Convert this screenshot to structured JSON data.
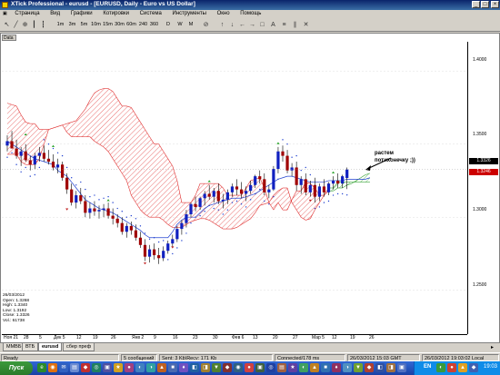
{
  "window": {
    "title": "XTick Professional - eurusd - [EURUSD, Daily - Euro vs US Dollar]",
    "min": "_",
    "max": "□",
    "close": "×"
  },
  "menu": [
    "Страница",
    "Вид",
    "Графики",
    "Котировки",
    "Система",
    "Инструменты",
    "Окно",
    "Помощь"
  ],
  "toolbar": {
    "timeframes": [
      "1m",
      "3m",
      "5m",
      "10m",
      "15m",
      "30m",
      "60m",
      "240",
      "360",
      "D",
      "W",
      "M"
    ]
  },
  "panel_label": "Data",
  "price_axis": {
    "ticks": [
      "1.4000",
      "1.3500",
      "1.3000",
      "1.2500"
    ],
    "last_price_tag": "1.3326",
    "bid_tag": "1.3246"
  },
  "time_axis": [
    "Ноя 21",
    "28",
    "5",
    "Дек 5",
    "12",
    "19",
    "26",
    "Янв 2",
    "9",
    "16",
    "23",
    "30",
    "Фев 6",
    "13",
    "20",
    "27",
    "Мар 5",
    "12",
    "19",
    "26"
  ],
  "infobox": {
    "date": "26/03/2012",
    "open": "Open: 1.3268",
    "high": "High: 1.3340",
    "low": "Low: 1.3192",
    "close": "Close: 1.3326",
    "vol": "Vol.: 61738"
  },
  "annotation": {
    "line1": "растем",
    "line2": "потихонечку ;))"
  },
  "tabs": [
    "ММВБ",
    "ВТБ",
    "eurusd",
    "сбер преф"
  ],
  "active_tab": "eurusd",
  "status": {
    "ready": "Ready",
    "messages": "5 сообщений",
    "traffic": "Sent: 3 Kb\\Recv: 171 Kb",
    "connected": "Connected/178 ms",
    "gmt": "26/03/2012 15:03 GMT",
    "local": "26/03/2012 19:03:02 Local"
  },
  "taskbar": {
    "start": "Пуск",
    "lang": "EN",
    "clock": "19:03"
  },
  "chart_data": {
    "type": "candlestick",
    "symbol": "EURUSD",
    "timeframe": "Daily",
    "ylim": [
      1.22,
      1.42
    ],
    "candles": [
      [
        1.349,
        1.356,
        1.345,
        1.352
      ],
      [
        1.352,
        1.359,
        1.348,
        1.347
      ],
      [
        1.347,
        1.353,
        1.34,
        1.342
      ],
      [
        1.342,
        1.348,
        1.335,
        1.345
      ],
      [
        1.345,
        1.35,
        1.338,
        1.339
      ],
      [
        1.339,
        1.342,
        1.332,
        1.336
      ],
      [
        1.336,
        1.344,
        1.333,
        1.342
      ],
      [
        1.342,
        1.348,
        1.338,
        1.344
      ],
      [
        1.344,
        1.349,
        1.338,
        1.34
      ],
      [
        1.34,
        1.346,
        1.336,
        1.338
      ],
      [
        1.338,
        1.343,
        1.332,
        1.334
      ],
      [
        1.334,
        1.34,
        1.33,
        1.336
      ],
      [
        1.336,
        1.338,
        1.325,
        1.327
      ],
      [
        1.327,
        1.33,
        1.316,
        1.319
      ],
      [
        1.319,
        1.323,
        1.308,
        1.31
      ],
      [
        1.31,
        1.318,
        1.306,
        1.315
      ],
      [
        1.315,
        1.32,
        1.309,
        1.311
      ],
      [
        1.311,
        1.315,
        1.3,
        1.303
      ],
      [
        1.303,
        1.31,
        1.299,
        1.306
      ],
      [
        1.306,
        1.311,
        1.301,
        1.304
      ],
      [
        1.304,
        1.308,
        1.299,
        1.305
      ],
      [
        1.305,
        1.309,
        1.3,
        1.306
      ],
      [
        1.306,
        1.31,
        1.299,
        1.301
      ],
      [
        1.301,
        1.306,
        1.295,
        1.299
      ],
      [
        1.299,
        1.302,
        1.293,
        1.296
      ],
      [
        1.296,
        1.3,
        1.288,
        1.29
      ],
      [
        1.29,
        1.296,
        1.286,
        1.294
      ],
      [
        1.294,
        1.297,
        1.288,
        1.291
      ],
      [
        1.291,
        1.295,
        1.284,
        1.286
      ],
      [
        1.286,
        1.29,
        1.279,
        1.281
      ],
      [
        1.281,
        1.285,
        1.27,
        1.273
      ],
      [
        1.273,
        1.281,
        1.269,
        1.278
      ],
      [
        1.278,
        1.282,
        1.271,
        1.274
      ],
      [
        1.274,
        1.279,
        1.268,
        1.272
      ],
      [
        1.272,
        1.28,
        1.27,
        1.277
      ],
      [
        1.277,
        1.284,
        1.275,
        1.282
      ],
      [
        1.282,
        1.288,
        1.279,
        1.285
      ],
      [
        1.285,
        1.294,
        1.283,
        1.292
      ],
      [
        1.292,
        1.298,
        1.288,
        1.296
      ],
      [
        1.296,
        1.305,
        1.293,
        1.302
      ],
      [
        1.302,
        1.31,
        1.3,
        1.309
      ],
      [
        1.309,
        1.314,
        1.304,
        1.307
      ],
      [
        1.307,
        1.314,
        1.305,
        1.313
      ],
      [
        1.313,
        1.318,
        1.308,
        1.316
      ],
      [
        1.316,
        1.322,
        1.312,
        1.314
      ],
      [
        1.314,
        1.32,
        1.31,
        1.318
      ],
      [
        1.318,
        1.323,
        1.309,
        1.311
      ],
      [
        1.311,
        1.316,
        1.306,
        1.312
      ],
      [
        1.312,
        1.319,
        1.309,
        1.317
      ],
      [
        1.317,
        1.323,
        1.314,
        1.321
      ],
      [
        1.321,
        1.326,
        1.315,
        1.319
      ],
      [
        1.319,
        1.324,
        1.313,
        1.316
      ],
      [
        1.316,
        1.321,
        1.311,
        1.318
      ],
      [
        1.318,
        1.325,
        1.316,
        1.322
      ],
      [
        1.322,
        1.329,
        1.32,
        1.328
      ],
      [
        1.328,
        1.332,
        1.323,
        1.326
      ],
      [
        1.326,
        1.33,
        1.315,
        1.317
      ],
      [
        1.317,
        1.322,
        1.313,
        1.319
      ],
      [
        1.319,
        1.335,
        1.318,
        1.333
      ],
      [
        1.333,
        1.348,
        1.33,
        1.345
      ],
      [
        1.345,
        1.349,
        1.338,
        1.342
      ],
      [
        1.342,
        1.346,
        1.33,
        1.332
      ],
      [
        1.332,
        1.337,
        1.328,
        1.334
      ],
      [
        1.334,
        1.338,
        1.318,
        1.322
      ],
      [
        1.322,
        1.328,
        1.316,
        1.326
      ],
      [
        1.326,
        1.33,
        1.315,
        1.317
      ],
      [
        1.317,
        1.325,
        1.314,
        1.322
      ],
      [
        1.322,
        1.327,
        1.31,
        1.314
      ],
      [
        1.314,
        1.323,
        1.311,
        1.321
      ],
      [
        1.321,
        1.326,
        1.314,
        1.317
      ],
      [
        1.317,
        1.324,
        1.315,
        1.323
      ],
      [
        1.323,
        1.328,
        1.319,
        1.325
      ],
      [
        1.325,
        1.33,
        1.32,
        1.323
      ],
      [
        1.323,
        1.329,
        1.32,
        1.328
      ],
      [
        1.3268,
        1.334,
        1.3192,
        1.3326
      ]
    ],
    "cloud_upper": [
      1.378,
      1.377,
      1.376,
      1.37,
      1.365,
      1.364,
      1.364,
      1.36,
      1.36,
      1.36,
      1.361,
      1.362,
      1.363,
      1.364,
      1.365,
      1.366,
      1.37,
      1.374,
      1.38,
      1.385,
      1.387,
      1.388,
      1.388,
      1.386,
      1.381,
      1.376,
      1.376,
      1.375,
      1.37,
      1.365,
      1.36,
      1.355,
      1.35,
      1.35,
      1.345,
      1.34,
      1.335,
      1.325,
      1.31,
      1.31,
      1.31,
      1.315,
      1.323,
      1.323,
      1.323,
      1.323,
      1.323,
      1.32,
      1.315,
      1.315,
      1.315,
      1.315,
      1.32,
      1.325,
      1.326,
      1.327,
      1.32,
      1.31,
      1.305,
      1.31,
      1.305,
      1.305,
      1.312,
      1.318,
      1.318,
      1.324,
      1.323,
      1.32,
      1.315,
      1.315,
      1.32,
      1.32,
      1.324,
      1.324,
      1.324,
      1.324,
      1.324,
      1.324,
      1.324,
      1.324
    ],
    "cloud_lower": [
      1.343,
      1.343,
      1.343,
      1.338,
      1.336,
      1.336,
      1.336,
      1.34,
      1.35,
      1.36,
      1.361,
      1.362,
      1.363,
      1.358,
      1.355,
      1.355,
      1.355,
      1.355,
      1.355,
      1.352,
      1.35,
      1.348,
      1.345,
      1.34,
      1.335,
      1.33,
      1.325,
      1.315,
      1.31,
      1.305,
      1.302,
      1.3,
      1.3,
      1.3,
      1.298,
      1.295,
      1.293,
      1.293,
      1.293,
      1.295,
      1.297,
      1.298,
      1.299,
      1.299,
      1.298,
      1.296,
      1.294,
      1.292,
      1.292,
      1.292,
      1.293,
      1.295,
      1.297,
      1.299,
      1.303,
      1.308,
      1.309,
      1.31,
      1.315,
      1.318,
      1.32,
      1.32,
      1.31,
      1.305,
      1.3,
      1.298,
      1.299,
      1.305,
      1.31,
      1.315,
      1.318,
      1.318,
      1.32,
      1.32,
      1.322,
      1.323,
      1.325,
      1.327,
      1.329,
      1.33
    ],
    "kijun": [
      1.352,
      1.35,
      1.348,
      1.346,
      1.344,
      1.342,
      1.34,
      1.339,
      1.338,
      1.337,
      1.336,
      1.332,
      1.33,
      1.328,
      1.324,
      1.32,
      1.316,
      1.312,
      1.31,
      1.308,
      1.306,
      1.305,
      1.304,
      1.303,
      1.301,
      1.299,
      1.297,
      1.295,
      1.293,
      1.291,
      1.288,
      1.286,
      1.286,
      1.286,
      1.286,
      1.286,
      1.29,
      1.295,
      1.298,
      1.3,
      1.3,
      1.3,
      1.303,
      1.306,
      1.308,
      1.309,
      1.31,
      1.311,
      1.312,
      1.313,
      1.313,
      1.313,
      1.314,
      1.315,
      1.316,
      1.318,
      1.32,
      1.322,
      1.324,
      1.326,
      1.327,
      1.328,
      1.328,
      1.327,
      1.326,
      1.325,
      1.324,
      1.324,
      1.324,
      1.324,
      1.325,
      1.325,
      1.325,
      1.325,
      1.326,
      1.326,
      1.326,
      1.326,
      1.326,
      1.327
    ]
  }
}
